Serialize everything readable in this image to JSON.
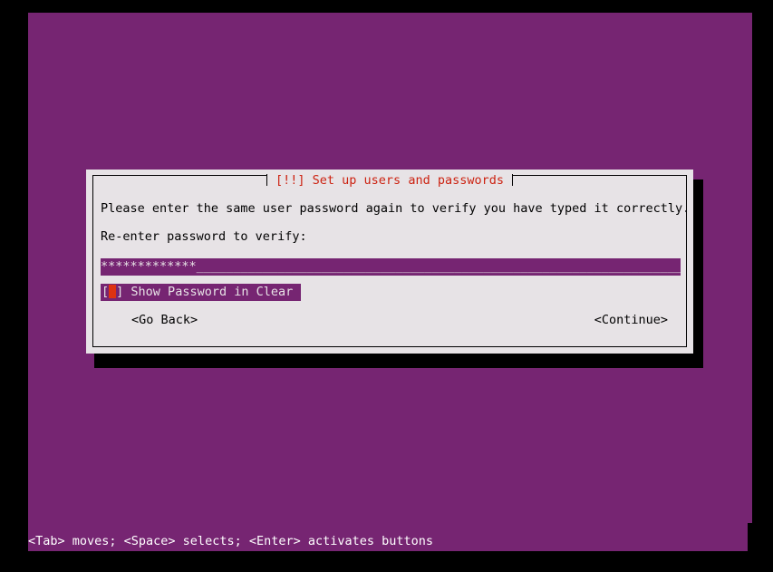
{
  "screen": {
    "background_color": "#000000",
    "canvas_color": "#762572"
  },
  "dialog": {
    "title": "[!!] Set up users and passwords",
    "title_color": "#cc2211",
    "background_color": "#e7e3e6",
    "intro_text": "Please enter the same user password again to verify you have typed it correctly.",
    "prompt_label": "Re-enter password to verify:",
    "password_field": {
      "masked_value": "*************",
      "filler": "______________________________________________________________________",
      "mask_character": "*",
      "character_count": 13,
      "background_color": "#762572",
      "text_color": "#e7e3e6"
    },
    "checkbox": {
      "open_bracket": "[",
      "close_bracket": "]",
      "checked": false,
      "label": "Show Password in Clear",
      "focused": true,
      "highlight_color": "#762572",
      "cursor_color": "#dd3311"
    },
    "buttons": {
      "go_back": "<Go Back>",
      "continue": "<Continue>"
    }
  },
  "statusbar": {
    "text": "<Tab> moves; <Space> selects; <Enter> activates buttons",
    "text_color": "#ffffff"
  }
}
